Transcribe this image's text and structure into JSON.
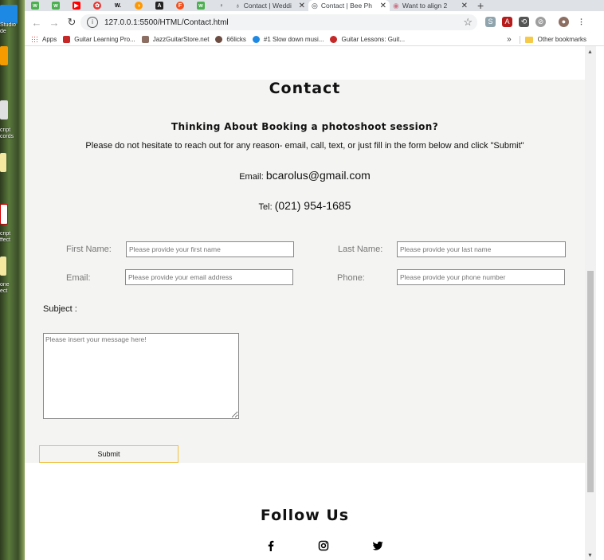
{
  "desktop": {
    "labels": [
      "Studio",
      "de",
      "cript",
      "cords",
      "cript",
      "ffect",
      "one",
      "ect"
    ]
  },
  "tabs": {
    "pinned": [
      {
        "icon": "green-tab-icon",
        "color": "#4caf50",
        "glyph": "w"
      },
      {
        "icon": "green-tab-icon",
        "color": "#4caf50",
        "glyph": "w"
      },
      {
        "icon": "youtube-icon",
        "color": "#ff0000",
        "glyph": "▶"
      },
      {
        "icon": "red-tab-icon",
        "color": "#e53935",
        "glyph": "✿"
      },
      {
        "icon": "w-icon",
        "color": "#ffffff",
        "glyph": "W."
      },
      {
        "icon": "orange-tab-icon",
        "color": "#ff9800",
        "glyph": "◑"
      },
      {
        "icon": "a-icon",
        "color": "#222222",
        "glyph": "A"
      },
      {
        "icon": "f-icon",
        "color": "#f4511e",
        "glyph": "F"
      },
      {
        "icon": "green-tab-icon",
        "color": "#4caf50",
        "glyph": "w"
      },
      {
        "icon": "pin-icon",
        "color": "#ffffff",
        "glyph": "♀"
      }
    ],
    "open": [
      {
        "title": "Contact | Weddi",
        "active": false
      },
      {
        "title": "Contact | Bee Ph",
        "active": true
      },
      {
        "title": "Want to align 2",
        "active": false
      }
    ],
    "new_tab": "+"
  },
  "toolbar": {
    "url": "127.0.0.1:5500/HTML/Contact.html"
  },
  "bookmarks": {
    "items": [
      {
        "label": "Apps",
        "color": "#e53935"
      },
      {
        "label": "Guitar Learning Pro...",
        "color": "#c62828"
      },
      {
        "label": "JazzGuitarStore.net",
        "color": "#8d6e63"
      },
      {
        "label": "66licks",
        "color": "#6d4c41"
      },
      {
        "label": "#1 Slow down musi...",
        "color": "#1e88e5"
      },
      {
        "label": "Guitar Lessons: Guit...",
        "color": "#c62828"
      }
    ],
    "overflow": "»",
    "other": "Other bookmarks"
  },
  "page": {
    "heading": "Contact",
    "subheading": "Thinking About Booking a photoshoot session?",
    "intro": "Please do not hesitate to reach out for any reason- email, call, text, or just fill in the form below and click \"Submit\"",
    "email_label": "Email:",
    "email_value": "bcarolus@gmail.com",
    "tel_label": "Tel:",
    "tel_value": "(021) 954-1685",
    "form": {
      "first_name_label": "First Name:",
      "first_name_placeholder": "Please provide your first name",
      "last_name_label": "Last Name:",
      "last_name_placeholder": "Please provide your last name",
      "email_label": "Email:",
      "email_placeholder": "Please provide your email address",
      "phone_label": "Phone:",
      "phone_placeholder": "Please provide your phone number",
      "subject_label": "Subject :",
      "message_placeholder": "Please insert your message here!",
      "submit_label": "Submit"
    },
    "follow_heading": "Follow Us"
  }
}
